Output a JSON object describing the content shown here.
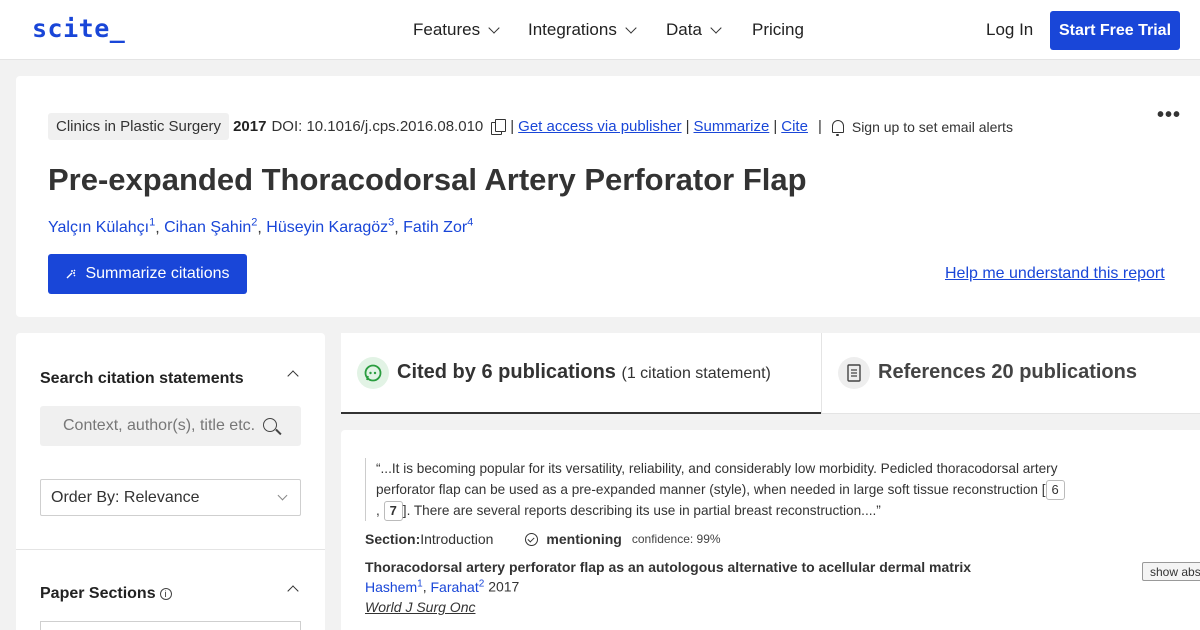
{
  "nav": {
    "logo": "scite_",
    "items": [
      {
        "label": "Features",
        "dropdown": true
      },
      {
        "label": "Integrations",
        "dropdown": true
      },
      {
        "label": "Data",
        "dropdown": true
      },
      {
        "label": "Pricing",
        "dropdown": false
      }
    ],
    "login": "Log In",
    "cta": "Start Free Trial"
  },
  "paper": {
    "journal": "Clinics in Plastic Surgery",
    "year": "2017",
    "doi": "DOI: 10.1016/j.cps.2016.08.010",
    "links": {
      "access": "Get access via publisher",
      "summarize": "Summarize",
      "cite": "Cite"
    },
    "alerts": "Sign up to set email alerts",
    "more": "•••",
    "title": "Pre-expanded Thoracodorsal Artery Perforator Flap",
    "authors": [
      {
        "name": "Yalçın Külahçı",
        "sup": "1"
      },
      {
        "name": "Cihan Şahin",
        "sup": "2"
      },
      {
        "name": "Hüseyin Karagöz",
        "sup": "3"
      },
      {
        "name": "Fatih Zor",
        "sup": "4"
      }
    ],
    "summarize_button": "Summarize citations",
    "help_link": "Help me understand this report"
  },
  "sidebar": {
    "search_heading": "Search citation statements",
    "search_placeholder": "Context, author(s), title etc.",
    "order_by": "Order By: Relevance",
    "sections_heading": "Paper Sections",
    "info": "i"
  },
  "tabs": {
    "cited": {
      "label": "Cited by 6 publications",
      "sub": "(1 citation statement)"
    },
    "references": {
      "label": "References 20 publications"
    }
  },
  "citation": {
    "quote_start": "“...It is becoming popular for its versatility, reliability, and considerably low morbidity. Pedicled thoracodorsal artery perforator flap can be used as a pre-expanded manner (style), when needed in large soft tissue reconstruction [",
    "ref_a": "6",
    "ref_b": "7",
    "quote_end": "]. There are several reports describing its use in partial breast reconstruction....”",
    "comma": ",",
    "section_label": "Section:",
    "section_value": " Introduction",
    "type": "mentioning",
    "confidence": "confidence: 99%",
    "paper_title": "Thoracodorsal artery perforator flap as an autologous alternative to acellular dermal matrix",
    "authors": [
      {
        "name": "Hashem",
        "sup": "1"
      },
      {
        "name": "Farahat",
        "sup": "2"
      }
    ],
    "year": "2017",
    "journal": "World J Surg Onc",
    "show_abstract": "show abstract"
  },
  "colors": {
    "brand": "#1946d8",
    "accent_green": "#2a9d3f"
  }
}
